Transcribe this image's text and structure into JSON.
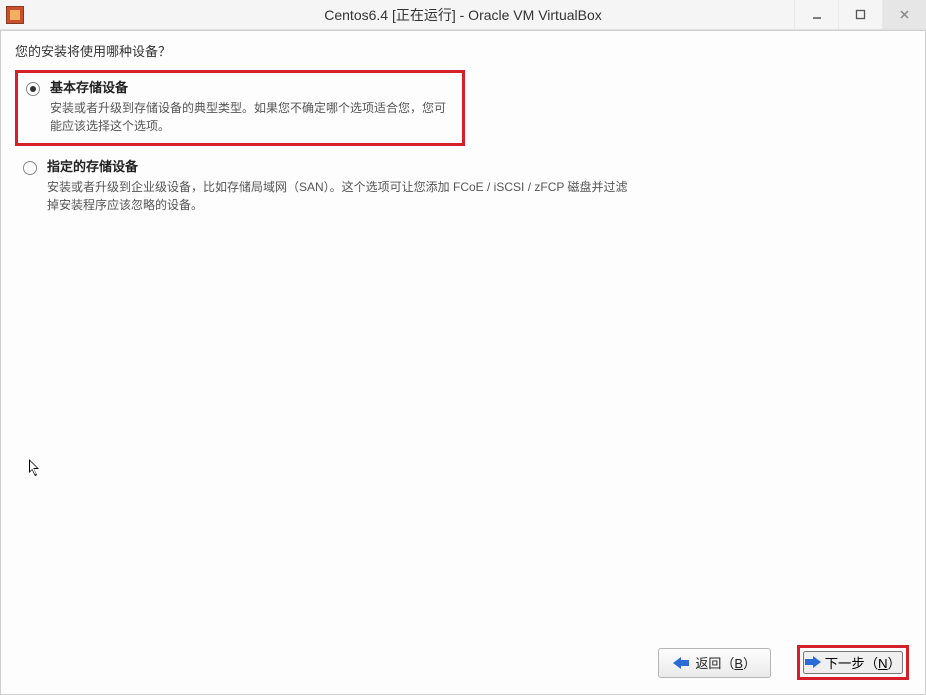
{
  "window": {
    "title": "Centos6.4 [正在运行] - Oracle VM VirtualBox"
  },
  "installer": {
    "prompt": "您的安装将使用哪种设备？",
    "options": [
      {
        "title": "基本存储设备",
        "desc": "安装或者升级到存储设备的典型类型。如果您不确定哪个选项适合您，您可能应该选择这个选项。",
        "selected": true
      },
      {
        "title": "指定的存储设备",
        "desc": "安装或者升级到企业级设备，比如存储局域网（SAN）。这个选项可让您添加 FCoE / iSCSI / zFCP 磁盘并过滤掉安装程序应该忽略的设备。",
        "selected": false
      }
    ],
    "buttons": {
      "back_prefix": "返回（",
      "back_key": "B",
      "back_suffix": "）",
      "next_prefix": "下一步（",
      "next_key": "N",
      "next_suffix": "）"
    }
  }
}
